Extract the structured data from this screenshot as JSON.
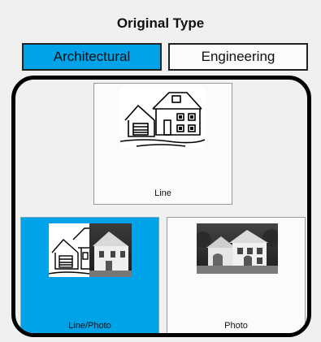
{
  "header": {
    "title": "Original Type"
  },
  "type_buttons": {
    "architectural": "Architectural",
    "engineering": "Engineering"
  },
  "tiles": {
    "line": "Line",
    "line_photo": "Line/Photo",
    "photo": "Photo"
  },
  "colors": {
    "selected": "#00a2e8",
    "panel_border": "#000000"
  },
  "icons": {
    "line": "line-drawing-house-icon",
    "line_photo": "line-photo-house-icon",
    "photo": "photo-house-icon"
  }
}
